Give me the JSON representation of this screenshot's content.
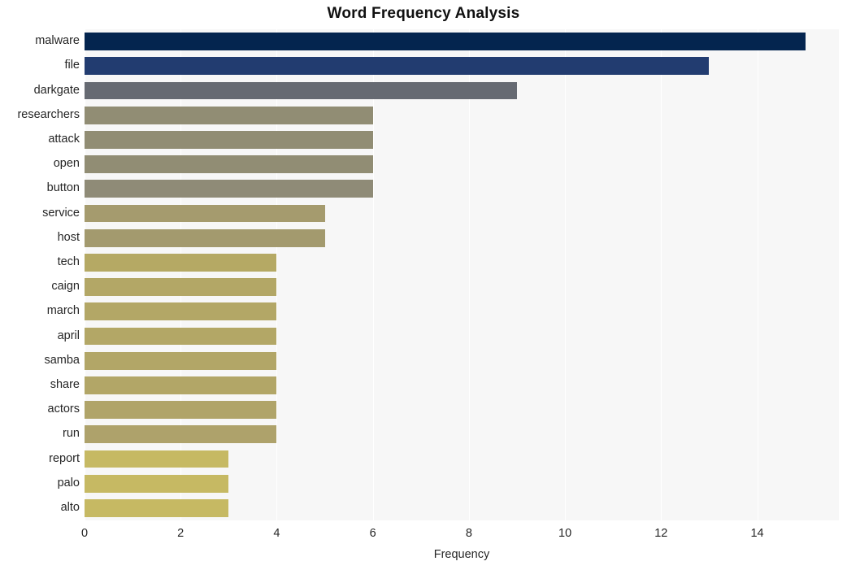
{
  "chart_data": {
    "type": "bar",
    "orientation": "horizontal",
    "title": "Word Frequency Analysis",
    "xlabel": "Frequency",
    "ylabel": "",
    "xlim": [
      0,
      15.7
    ],
    "xticks": [
      "0",
      "2",
      "4",
      "6",
      "8",
      "10",
      "12",
      "14"
    ],
    "xtick_values": [
      0,
      2,
      4,
      6,
      8,
      10,
      12,
      14
    ],
    "grid": "vertical",
    "legend": "none",
    "categories": [
      "malware",
      "file",
      "darkgate",
      "researchers",
      "attack",
      "open",
      "button",
      "service",
      "host",
      "tech",
      "caign",
      "march",
      "april",
      "samba",
      "share",
      "actors",
      "run",
      "report",
      "palo",
      "alto"
    ],
    "values": [
      15,
      13,
      9,
      6,
      6,
      6,
      6,
      5,
      5,
      4,
      4,
      4,
      4,
      4,
      4,
      4,
      4,
      3,
      3,
      3
    ],
    "bar_colors": [
      "#04254f",
      "#223c70",
      "#666a72",
      "#918d74",
      "#918d74",
      "#918d74",
      "#8f8b77",
      "#a59b6e",
      "#a39a6e",
      "#b5a964",
      "#b3a766",
      "#b3a766",
      "#b3a766",
      "#b2a667",
      "#b2a667",
      "#b0a469",
      "#aea26b",
      "#c6b963",
      "#c6b963",
      "#c6b963"
    ],
    "plot_background": "#f7f7f7",
    "gridline_color": "#ffffff"
  }
}
